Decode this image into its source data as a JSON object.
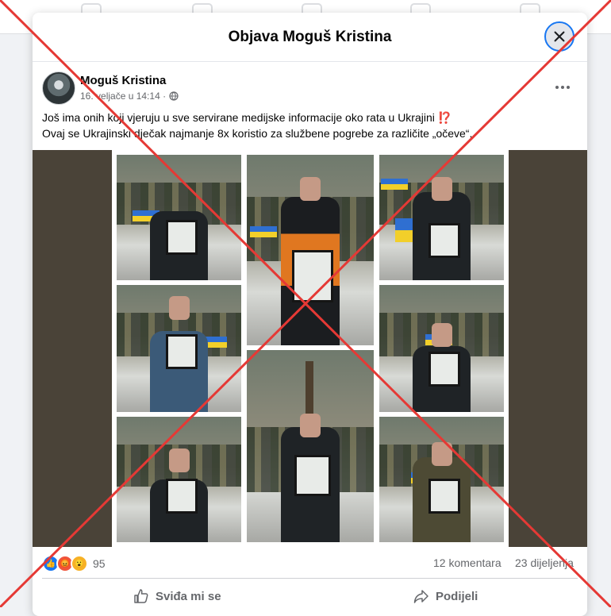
{
  "modal": {
    "title": "Objava Moguš Kristina"
  },
  "post": {
    "author": "Moguš Kristina",
    "timestamp": "16. veljače u 14:14 ·",
    "text_line1": "Još ima onih koji vjeruju u sve servirane medijske informacije oko rata u Ukrajini ⁉️",
    "text_line2": "Ovaj se Ukrajinski dječak najmanje 8x  koristio za službene pogrebe za različite „očeve“."
  },
  "stats": {
    "reactions_count": "95",
    "comments": "12 komentara",
    "shares": "23 dijeljenja"
  },
  "actions": {
    "like_label": "Sviđa mi se",
    "share_label": "Podijeli"
  },
  "colors": {
    "overlay_x": "#e53935",
    "like": "#1877f2",
    "angry": "#f0533b",
    "wow": "#f7b125"
  },
  "icons": [
    "close-icon",
    "globe-icon",
    "more-icon",
    "like-icon",
    "share-icon"
  ]
}
